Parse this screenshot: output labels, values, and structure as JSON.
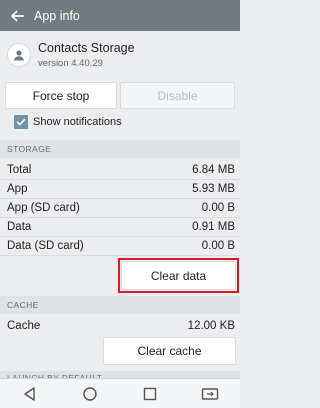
{
  "appbar": {
    "title": "App info"
  },
  "app": {
    "name": "Contacts Storage",
    "version": "version 4.40.29"
  },
  "buttons": {
    "force_stop": "Force stop",
    "disable": "Disable",
    "clear_data": "Clear data",
    "clear_cache": "Clear cache"
  },
  "notifications": {
    "label": "Show notifications",
    "checked": true
  },
  "storage": {
    "header": "STORAGE",
    "rows": [
      {
        "label": "Total",
        "value": "6.84 MB"
      },
      {
        "label": "App",
        "value": "5.93 MB"
      },
      {
        "label": "App (SD card)",
        "value": "0.00 B"
      },
      {
        "label": "Data",
        "value": "0.91 MB"
      },
      {
        "label": "Data (SD card)",
        "value": "0.00 B"
      }
    ]
  },
  "cache": {
    "header": "CACHE",
    "label": "Cache",
    "value": "12.00 KB"
  },
  "launch": {
    "header": "LAUNCH BY DEFAULT"
  },
  "colors": {
    "appbar": "#6f7b80",
    "highlight": "#d71d27",
    "checkbox": "#6c93a6"
  },
  "nav": {
    "icons": [
      "back-icon",
      "home-icon",
      "recents-icon",
      "switch-window-icon"
    ]
  }
}
